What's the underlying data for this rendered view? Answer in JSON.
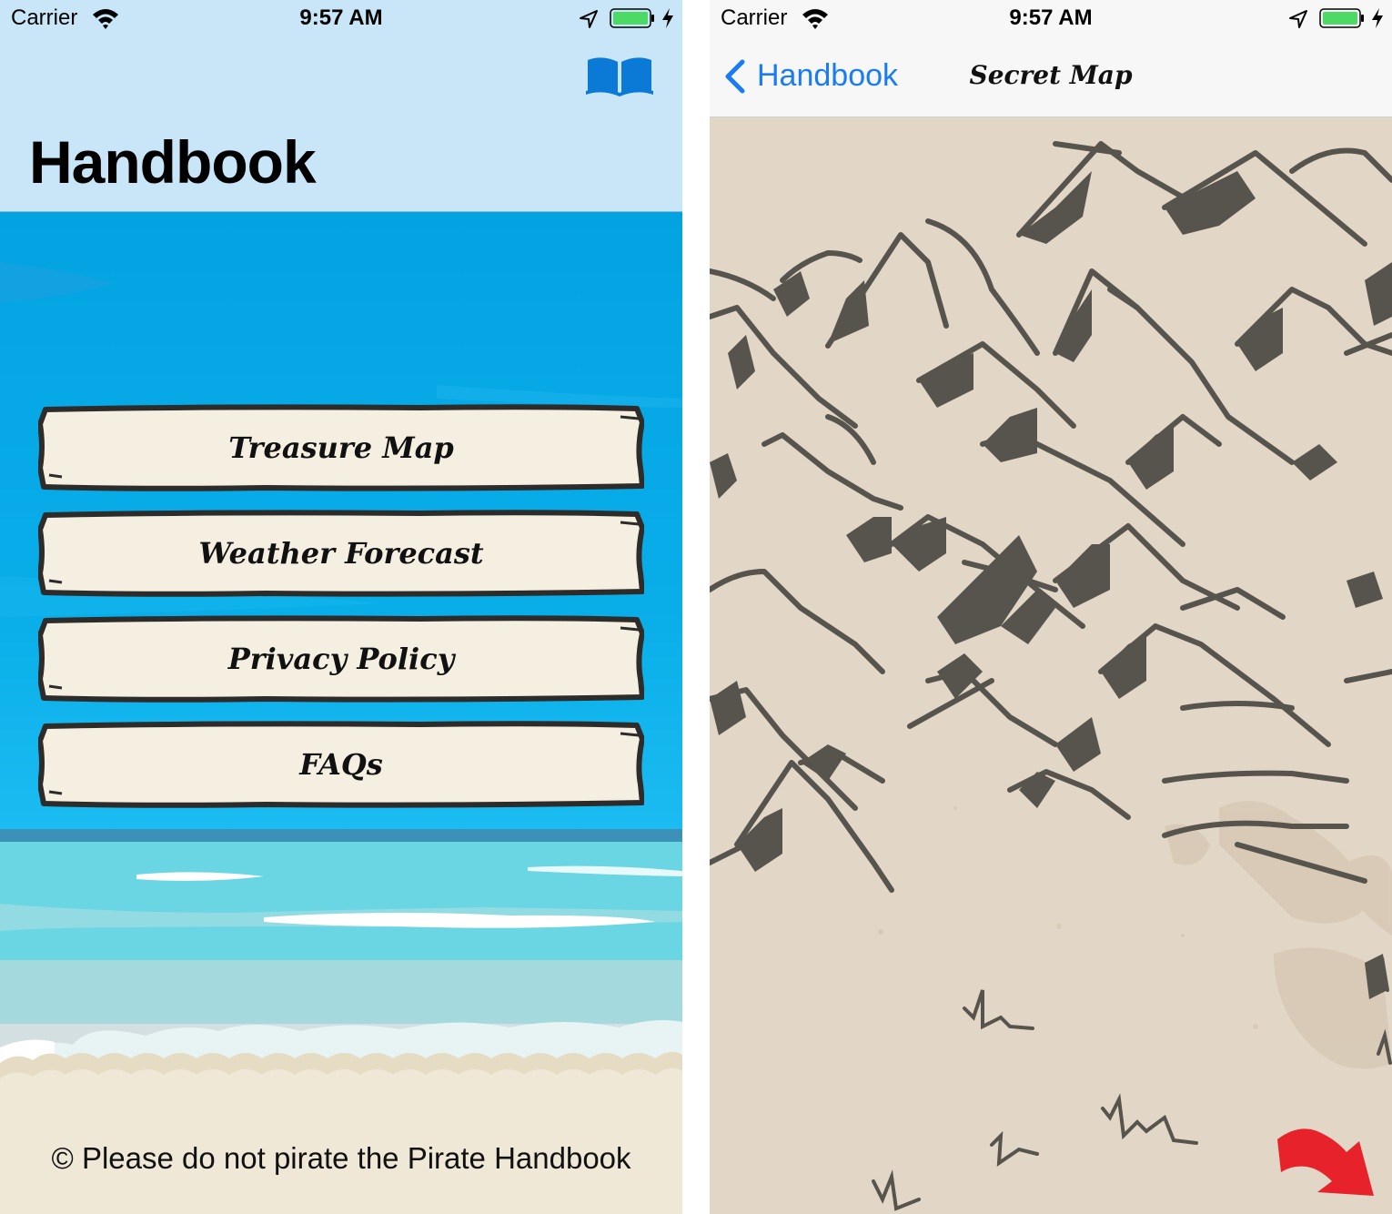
{
  "status_bar": {
    "carrier": "Carrier",
    "time": "9:57 AM"
  },
  "handbook_screen": {
    "title": "Handbook",
    "menu": [
      {
        "label": "Treasure Map"
      },
      {
        "label": "Weather Forecast"
      },
      {
        "label": "Privacy Policy"
      },
      {
        "label": "FAQs"
      }
    ],
    "footer": "© Please do not pirate the Pirate Handbook",
    "icons": {
      "nav_right": "book-open-icon"
    }
  },
  "map_screen": {
    "back_label": "Handbook",
    "title": "Secret Map",
    "icons": {
      "back": "chevron-left-icon",
      "arrow": "red-arrow-icon"
    }
  },
  "colors": {
    "nav_blue": "#c8e6f8",
    "sea": "#03a3e2",
    "plank": "#f5efe2",
    "sand": "#eee6d4",
    "map": "#e2d6c6",
    "ink": "#57544e",
    "ios_blue": "#1a7cf5",
    "battery_green": "#4cd964",
    "arrow_red": "#e8222a"
  }
}
